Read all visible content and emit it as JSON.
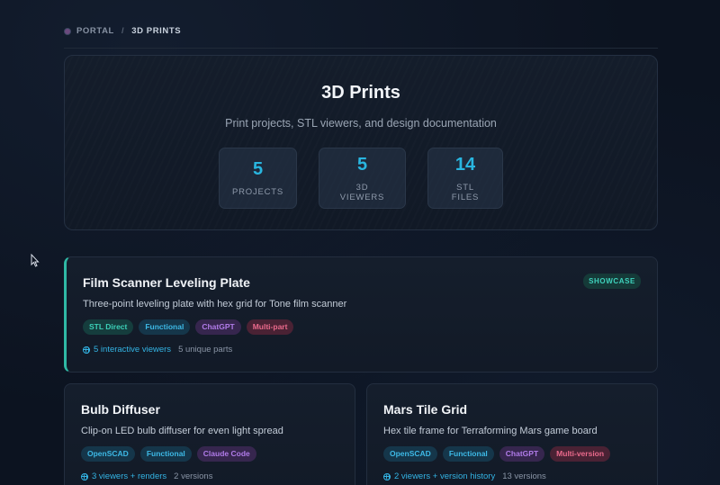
{
  "breadcrumb": {
    "root": "PORTAL",
    "separator": "/",
    "current": "3D PRINTS"
  },
  "hero": {
    "title": "3D Prints",
    "subtitle": "Print projects, STL viewers, and design documentation",
    "stats": [
      {
        "value": "5",
        "label": "PROJECTS"
      },
      {
        "value": "5",
        "label": "3D VIEWERS"
      },
      {
        "value": "14",
        "label": "STL FILES"
      }
    ]
  },
  "projects": [
    {
      "title": "Film Scanner Leveling Plate",
      "badge": "SHOWCASE",
      "description": "Three-point leveling plate with hex grid for Tone film scanner",
      "tags": [
        "STL Direct",
        "Functional",
        "ChatGPT",
        "Multi-part"
      ],
      "link": "5 interactive viewers",
      "extra": "5 unique parts"
    },
    {
      "title": "Bulb Diffuser",
      "description": "Clip-on LED bulb diffuser for even light spread",
      "tags": [
        "OpenSCAD",
        "Functional",
        "Claude Code"
      ],
      "link": "3 viewers + renders",
      "extra": "2 versions"
    },
    {
      "title": "Mars Tile Grid",
      "description": "Hex tile frame for Terraforming Mars game board",
      "tags": [
        "OpenSCAD",
        "Functional",
        "ChatGPT",
        "Multi-version"
      ],
      "link": "2 viewers + version history",
      "extra": "13 versions"
    }
  ],
  "colors": {
    "accent": "#29b6e0",
    "showcase": "#2fb9a5",
    "tag_teal": "#3cd1b8",
    "tag_blue": "#3db9e6",
    "tag_purple": "#b07be8",
    "tag_pink": "#ea6a8c"
  }
}
